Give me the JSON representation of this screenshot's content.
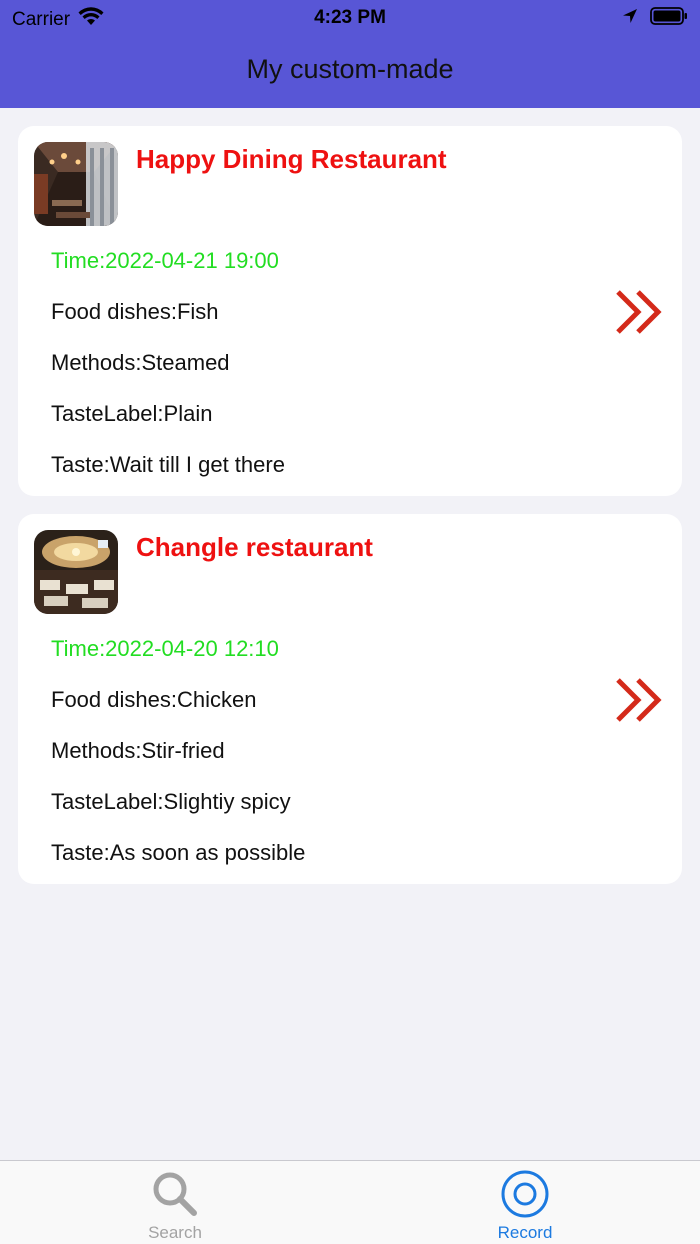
{
  "status_bar": {
    "carrier": "Carrier",
    "time": "4:23 PM"
  },
  "header": {
    "title": "My custom-made",
    "color": "#5856d6"
  },
  "records": [
    {
      "name": "Happy Dining Restaurant",
      "time": "Time:2022-04-21 19:00",
      "dishes": "Food dishes:Fish",
      "methods": "Methods:Steamed",
      "taste_label": "TasteLabel:Plain",
      "taste": "Taste:Wait till I get there"
    },
    {
      "name": "Changle restaurant",
      "time": "Time:2022-04-20 12:10",
      "dishes": "Food dishes:Chicken",
      "methods": "Methods:Stir-fried",
      "taste_label": "TasteLabel:Slightiy spicy",
      "taste": "Taste:As soon as possible"
    }
  ],
  "tabbar": {
    "tabs": [
      {
        "label": "Search",
        "icon": "search-icon",
        "active": false
      },
      {
        "label": "Record",
        "icon": "record-icon",
        "active": true
      }
    ]
  },
  "colors": {
    "name": "#ee1111",
    "time": "#22dd22",
    "arrow": "#d42a1a",
    "active_tab": "#1c7ae0"
  }
}
